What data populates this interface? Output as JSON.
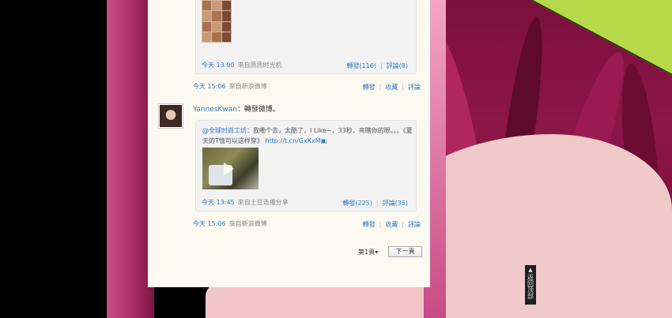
{
  "post1": {
    "quoted_meta": {
      "time": "今天 13:00",
      "source": "來自质质时光机"
    },
    "quoted_actions": {
      "repost": "轉發(116)",
      "comment": "評論(8)"
    },
    "meta": {
      "time": "今天 15:06",
      "source": "來自新浪微博"
    },
    "actions": {
      "repost": "轉發",
      "favorite": "收藏",
      "comment": "評論"
    }
  },
  "post2": {
    "author": "YannesKwan",
    "text": "：轉發微博。",
    "quoted": {
      "mention": "@全球时尚工坊",
      "text": "：我嘞个去，太酷了，I Like~，33秒，亮瞎你的眼。。。《夏天的T恤可以这样穿》",
      "url": "http://t.cn/GxKxM"
    },
    "quoted_meta": {
      "time": "今天 13:45",
      "source": "來自土豆连播分享"
    },
    "quoted_actions": {
      "repost": "轉發(225)",
      "comment": "評論(35)"
    },
    "meta": {
      "time": "今天 15:06",
      "source": "來自新浪微博"
    },
    "actions": {
      "repost": "轉發",
      "favorite": "收藏",
      "comment": "評論"
    }
  },
  "pager": {
    "page_label": "第1頁▾",
    "next_label": "下一頁"
  },
  "back_to_top": {
    "label": "返回顶部"
  }
}
